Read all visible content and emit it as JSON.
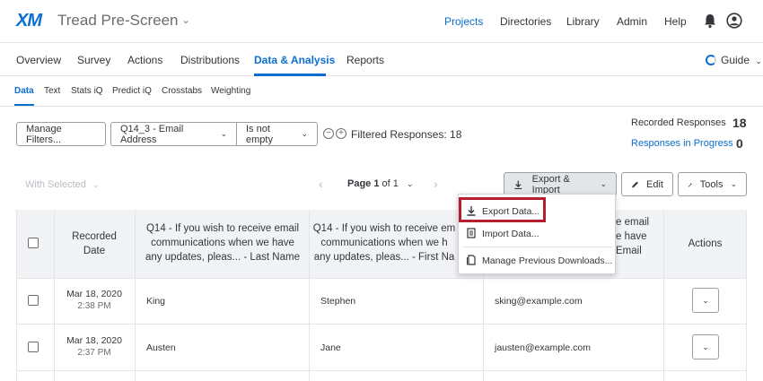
{
  "app": {
    "logo": "XM",
    "project_title": "Tread Pre-Screen",
    "project_chevron": "⌄"
  },
  "top_nav": [
    {
      "label": "Projects",
      "active": true
    },
    {
      "label": "Directories",
      "active": false
    },
    {
      "label": "Library",
      "active": false
    },
    {
      "label": "Admin",
      "active": false
    },
    {
      "label": "Help",
      "active": false
    }
  ],
  "main_tabs": [
    {
      "label": "Overview"
    },
    {
      "label": "Survey"
    },
    {
      "label": "Actions"
    },
    {
      "label": "Distributions"
    },
    {
      "label": "Data & Analysis",
      "active": true
    },
    {
      "label": "Reports"
    }
  ],
  "guide_label": "Guide",
  "sub_tabs": [
    {
      "label": "Data",
      "active": true
    },
    {
      "label": "Text"
    },
    {
      "label": "Stats iQ"
    },
    {
      "label": "Predict iQ"
    },
    {
      "label": "Crosstabs"
    },
    {
      "label": "Weighting"
    }
  ],
  "filters": {
    "manage_label": "Manage Filters...",
    "field_label": "Q14_3 - Email Address",
    "condition_label": "Is not empty",
    "filtered_text": "Filtered Responses: 18"
  },
  "summary": {
    "recorded_label": "Recorded Responses",
    "recorded_count": "18",
    "in_progress_label": "Responses in Progress",
    "in_progress_count": "0"
  },
  "toolbar": {
    "with_selected": "With Selected",
    "page_prefix": "Page",
    "page_current": "1",
    "page_of": "of",
    "page_total": "1",
    "export_label": "Export & Import",
    "edit_label": "Edit",
    "tools_label": "Tools"
  },
  "table": {
    "headers": {
      "recorded_date_1": "Recorded",
      "recorded_date_2": "Date",
      "col_last_1": "Q14 - If you wish to receive email",
      "col_last_2": "communications when we have",
      "col_last_3": "any updates, pleas... - Last Name",
      "col_first_1": "Q14 - If you wish to receive em",
      "col_first_2": "communications when we h",
      "col_first_3": "any updates, pleas... - First Na",
      "col_email_1": "e email",
      "col_email_2": "e have",
      "col_email_3": "Email",
      "actions": "Actions"
    },
    "rows": [
      {
        "date": "Mar 18, 2020",
        "time": "2:38 PM",
        "last": "King",
        "first": "Stephen",
        "email": "sking@example.com"
      },
      {
        "date": "Mar 18, 2020",
        "time": "2:37 PM",
        "last": "Austen",
        "first": "Jane",
        "email": "jausten@example.com"
      }
    ]
  },
  "export_menu": {
    "items": [
      {
        "label": "Export Data..."
      },
      {
        "label": "Import Data..."
      },
      {
        "label": "Manage Previous Downloads..."
      }
    ]
  }
}
